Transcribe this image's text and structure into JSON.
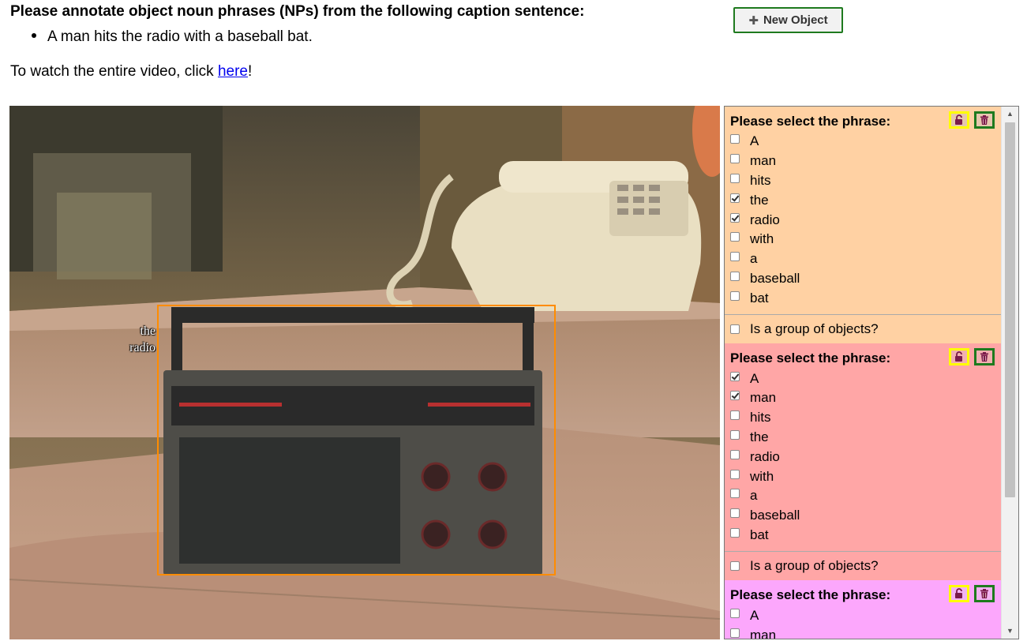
{
  "instruction": {
    "title": "Please annotate object noun phrases (NPs) from the following caption sentence:",
    "caption": "A man hits the radio with a baseball bat.",
    "watch_prefix": "To watch the entire video, click ",
    "watch_link": "here",
    "watch_suffix": "!"
  },
  "toolbar": {
    "new_object_label": "New Object",
    "new_object_icon": "plus-icon"
  },
  "video": {
    "bbox_label_line1": "the",
    "bbox_label_line2": "radio",
    "bbox_color": "#ff8c00"
  },
  "panel": {
    "phrase_prompt": "Please select the phrase:",
    "group_prompt": "Is a group of objects?",
    "objects": [
      {
        "color": "#ffd1a3",
        "words": [
          {
            "text": "A",
            "checked": false
          },
          {
            "text": "man",
            "checked": false
          },
          {
            "text": "hits",
            "checked": false
          },
          {
            "text": "the",
            "checked": true
          },
          {
            "text": "radio",
            "checked": true
          },
          {
            "text": "with",
            "checked": false
          },
          {
            "text": "a",
            "checked": false
          },
          {
            "text": "baseball",
            "checked": false
          },
          {
            "text": "bat",
            "checked": false
          }
        ],
        "is_group": false
      },
      {
        "color": "#ffa6a6",
        "words": [
          {
            "text": "A",
            "checked": true
          },
          {
            "text": "man",
            "checked": true
          },
          {
            "text": "hits",
            "checked": false
          },
          {
            "text": "the",
            "checked": false
          },
          {
            "text": "radio",
            "checked": false
          },
          {
            "text": "with",
            "checked": false
          },
          {
            "text": "a",
            "checked": false
          },
          {
            "text": "baseball",
            "checked": false
          },
          {
            "text": "bat",
            "checked": false
          }
        ],
        "is_group": false
      },
      {
        "color": "#fca7fc",
        "words": [
          {
            "text": "A",
            "checked": false
          },
          {
            "text": "man",
            "checked": false
          }
        ],
        "is_group": false
      }
    ]
  }
}
